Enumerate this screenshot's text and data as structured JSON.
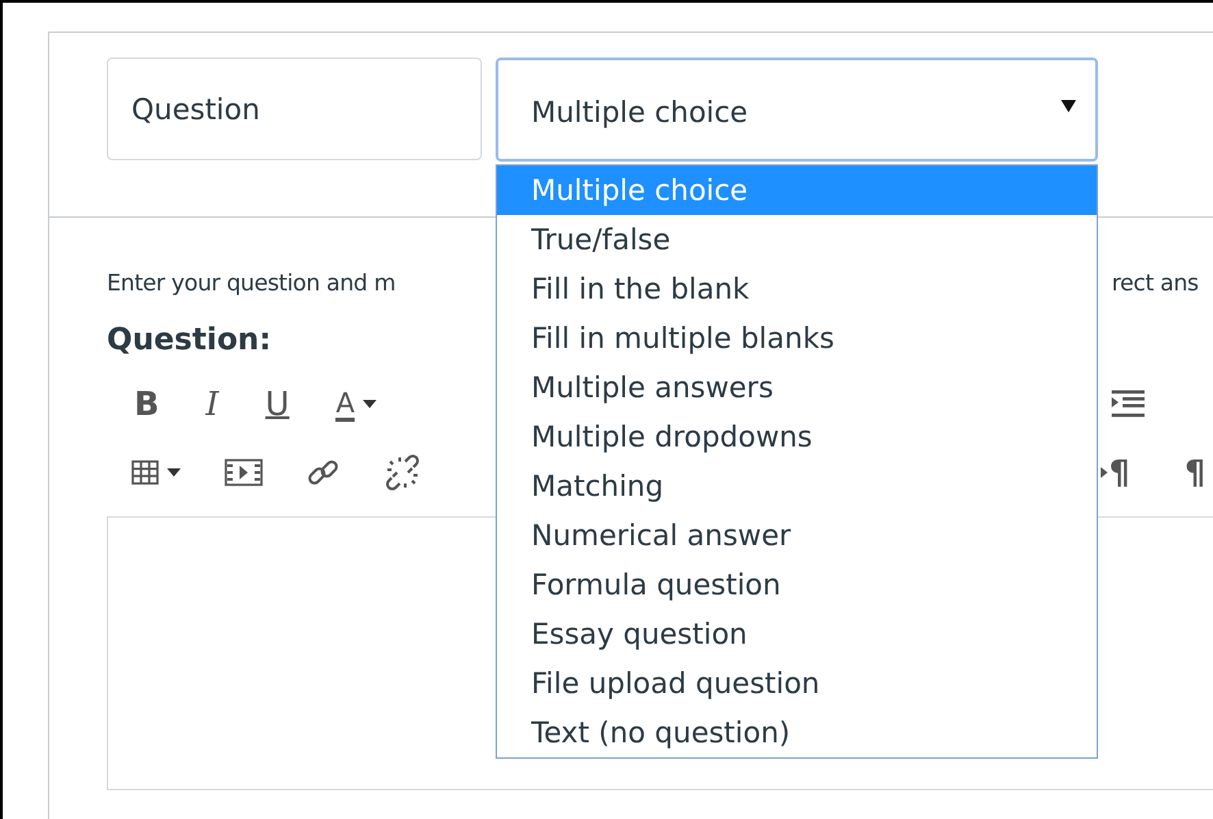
{
  "question_name": {
    "value": "Question"
  },
  "question_type": {
    "value": "Multiple choice",
    "expanded": true,
    "options": [
      {
        "label": "Multiple choice",
        "selected": true
      },
      {
        "label": "True/false",
        "selected": false
      },
      {
        "label": "Fill in the blank",
        "selected": false
      },
      {
        "label": "Fill in multiple blanks",
        "selected": false
      },
      {
        "label": "Multiple answers",
        "selected": false
      },
      {
        "label": "Multiple dropdowns",
        "selected": false
      },
      {
        "label": "Matching",
        "selected": false
      },
      {
        "label": "Numerical answer",
        "selected": false
      },
      {
        "label": "Formula question",
        "selected": false
      },
      {
        "label": "Essay question",
        "selected": false
      },
      {
        "label": "File upload question",
        "selected": false
      },
      {
        "label": "Text (no question)",
        "selected": false
      }
    ]
  },
  "instructions": {
    "visible_start": "Enter your question and m",
    "visible_end": "rect ans"
  },
  "editor": {
    "heading": "Question:",
    "format_buttons": [
      {
        "kind": "bold",
        "label": "B"
      },
      {
        "kind": "italic",
        "label": "I"
      },
      {
        "kind": "underline",
        "label": "U"
      },
      {
        "kind": "color",
        "label": "A"
      }
    ],
    "paragraph_buttons": [
      {
        "kind": "ltr",
        "label": "¶"
      },
      {
        "kind": "rtl",
        "label": "¶"
      }
    ]
  }
}
